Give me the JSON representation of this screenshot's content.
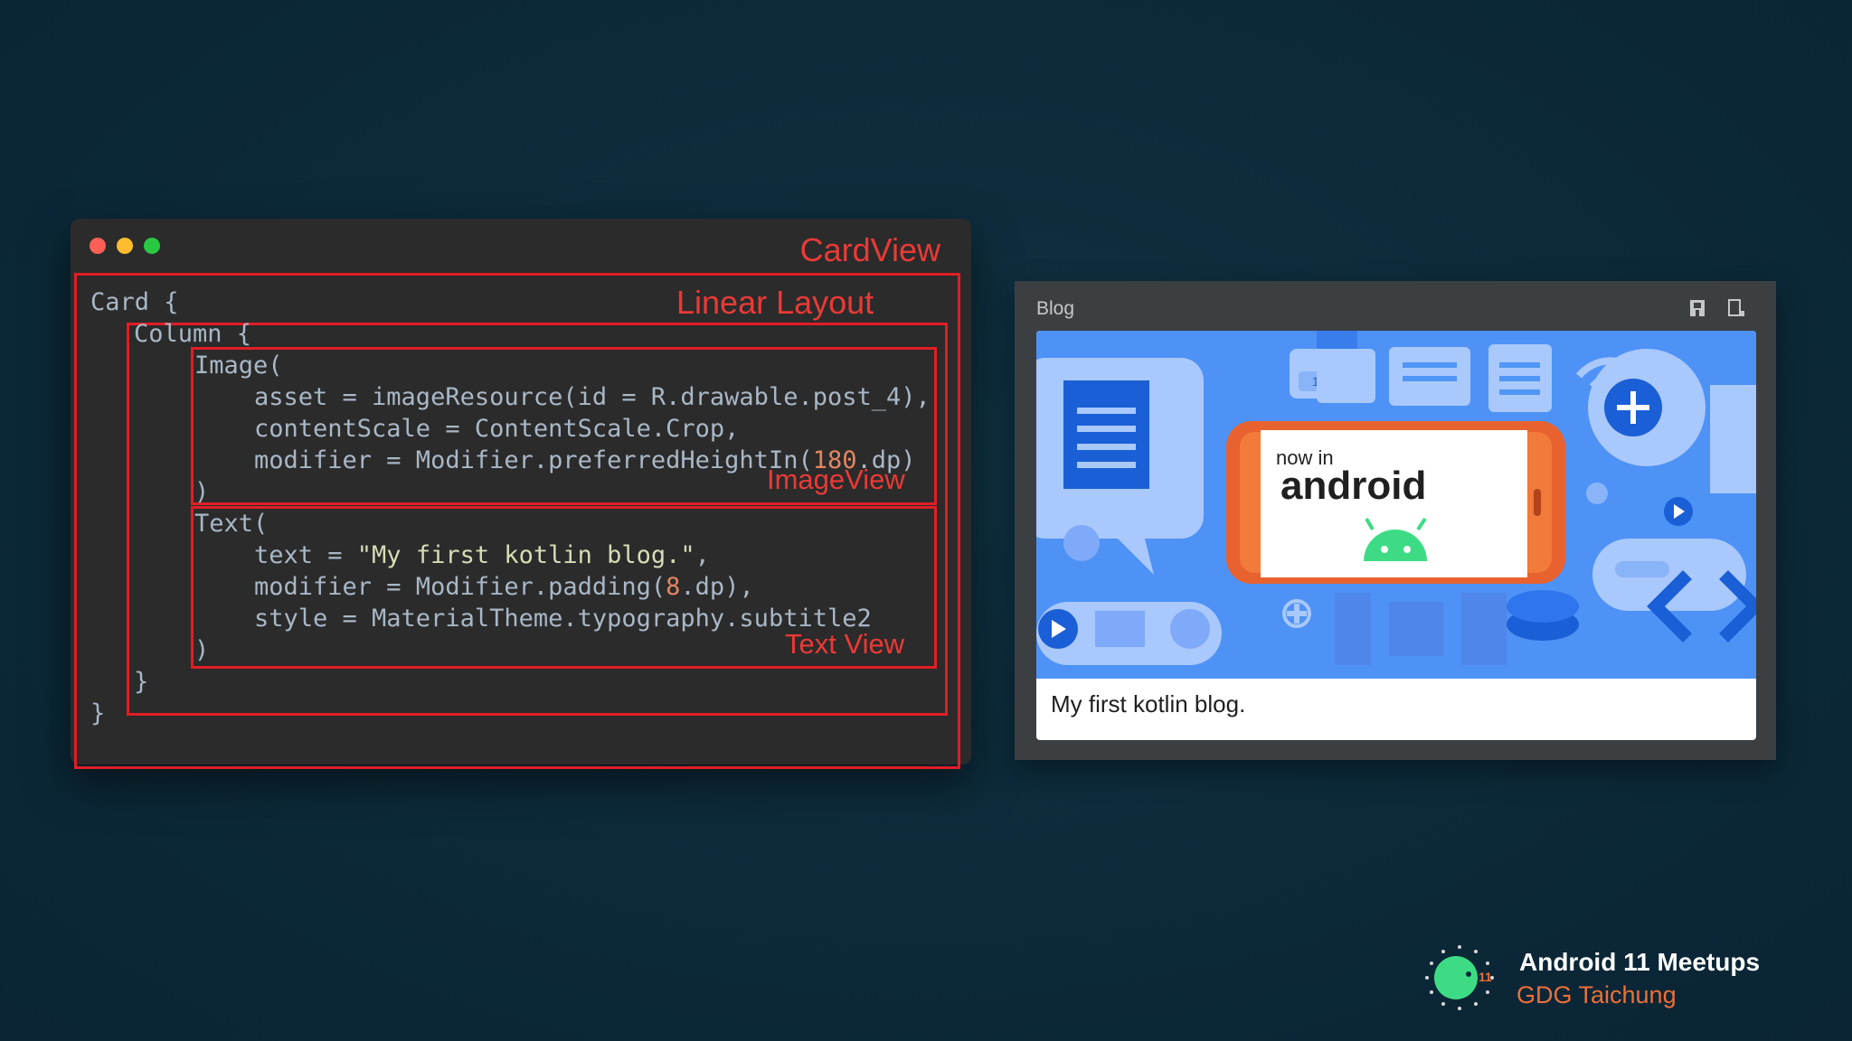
{
  "labels": {
    "cardview": "CardView",
    "linear_layout": "Linear Layout",
    "imageview": "ImageView",
    "textview": "Text View"
  },
  "code": {
    "l1": "Card {",
    "l2": "Column {",
    "l3": "Image(",
    "l4": "asset = imageResource(id = R.drawable.post_4),",
    "l5": "contentScale = ContentScale.Crop,",
    "l6_a": "modifier = Modifier.preferredHeightIn(",
    "l6_num": "180",
    "l6_b": ".dp)",
    "l7": ")",
    "l8": "Text(",
    "l9_a": "text = ",
    "l9_str": "\"My first kotlin blog.\"",
    "l9_b": ",",
    "l10_a": "modifier = Modifier.padding(",
    "l10_num": "8",
    "l10_b": ".dp),",
    "l11": "style = MaterialTheme.typography.subtitle2",
    "l12": ")",
    "l13": "}",
    "l14": "}"
  },
  "preview": {
    "title": "Blog",
    "image_text_small": "now in",
    "image_text_big": "android",
    "image_badge": "13sp",
    "caption": "My first kotlin blog."
  },
  "branding": {
    "title": "Android 11 Meetups",
    "subtitle": "GDG Taichung",
    "logo_badge": "11"
  },
  "colors": {
    "background": "#0c2a3a",
    "highlight": "#e01e25",
    "brand_orange": "#ed6f39",
    "android_green": "#3ddc84"
  }
}
